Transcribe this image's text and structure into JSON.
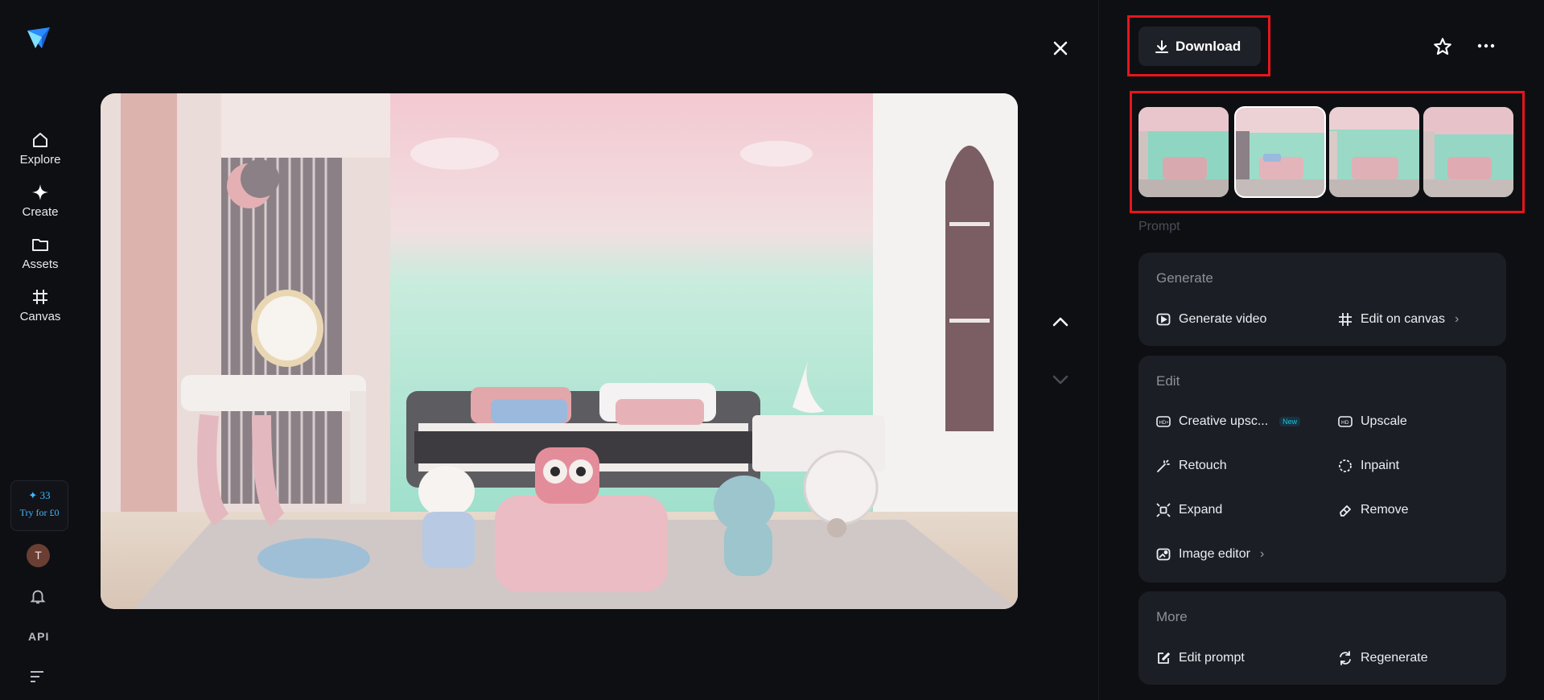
{
  "sidebar": {
    "items": [
      {
        "label": "Explore",
        "icon": "home-icon"
      },
      {
        "label": "Create",
        "icon": "sparkle-icon"
      },
      {
        "label": "Assets",
        "icon": "folder-icon"
      },
      {
        "label": "Canvas",
        "icon": "canvas-icon"
      }
    ],
    "credits": {
      "count": "✦ 33",
      "cta": "Try for £0"
    },
    "avatar_initial": "T",
    "api_label": "API"
  },
  "toolbar": {
    "download_label": "Download"
  },
  "prompt_label": "Prompt",
  "generate": {
    "title": "Generate",
    "actions": [
      {
        "label": "Generate video",
        "icon": "play-icon"
      },
      {
        "label": "Edit on canvas",
        "icon": "canvas-icon"
      }
    ]
  },
  "edit": {
    "title": "Edit",
    "actions": [
      {
        "label": "Creative upsc...",
        "icon": "hd-plus-icon",
        "badge": "New"
      },
      {
        "label": "Upscale",
        "icon": "hd-icon"
      },
      {
        "label": "Retouch",
        "icon": "magic-wand-icon"
      },
      {
        "label": "Inpaint",
        "icon": "inpaint-icon"
      },
      {
        "label": "Expand",
        "icon": "expand-icon"
      },
      {
        "label": "Remove",
        "icon": "eraser-icon"
      },
      {
        "label": "Image editor",
        "icon": "image-edit-icon"
      }
    ]
  },
  "more": {
    "title": "More",
    "actions": [
      {
        "label": "Edit prompt",
        "icon": "edit-icon"
      },
      {
        "label": "Regenerate",
        "icon": "refresh-icon"
      }
    ]
  },
  "colors": {
    "background": "#0e0f13",
    "card": "#1c1e25",
    "highlight": "#e8151b",
    "accent": "#44b8ff"
  }
}
